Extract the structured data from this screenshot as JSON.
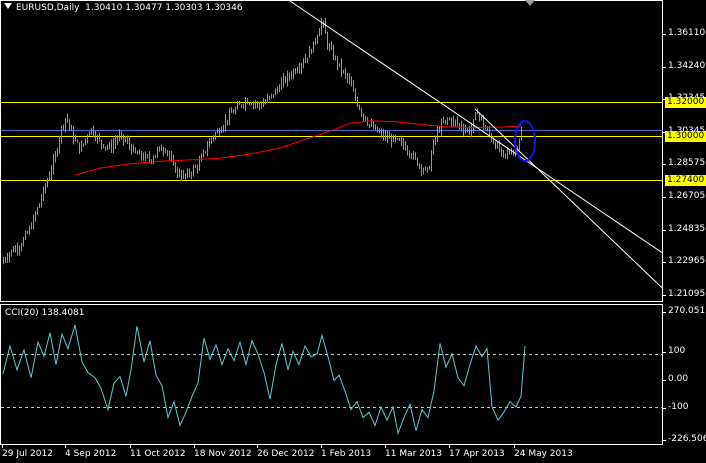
{
  "header": {
    "symbol": "EURUSD,Daily",
    "ohlc": "1.30410 1.30477 1.30303 1.30346"
  },
  "indicator": {
    "label": "CCI(20) 138.4081"
  },
  "colors": {
    "background": "#000000",
    "candles": "#00ff00",
    "moving_average": "#ff0000",
    "horizontal_levels": "#ffff00",
    "channel_lines": "#ffffff",
    "cci_line": "#5fc9d6",
    "highlight_ellipse": "#1010ff",
    "blue_level": "#4f6fd0"
  },
  "chart_data": [
    {
      "type": "candlestick",
      "symbol": "EURUSD",
      "timeframe": "Daily",
      "ylim": [
        1.203,
        1.3795
      ],
      "y_ticks": [
        "1.36110",
        "1.34240",
        "1.32345",
        "1.30345",
        "1.28575",
        "1.26705",
        "1.24835",
        "1.22965",
        "1.21095"
      ],
      "x_labels": [
        "29 Jul 2012",
        "4 Sep 2012",
        "11 Oct 2012",
        "18 Nov 2012",
        "26 Dec 2012",
        "1 Feb 2013",
        "11 Mar 2013",
        "17 Apr 2013",
        "24 May 2013"
      ],
      "close_path": [
        [
          0,
          1.225
        ],
        [
          10,
          1.232
        ],
        [
          20,
          1.236
        ],
        [
          30,
          1.246
        ],
        [
          40,
          1.262
        ],
        [
          48,
          1.276
        ],
        [
          55,
          1.288
        ],
        [
          60,
          1.303
        ],
        [
          66,
          1.312
        ],
        [
          72,
          1.3
        ],
        [
          80,
          1.292
        ],
        [
          90,
          1.305
        ],
        [
          100,
          1.296
        ],
        [
          110,
          1.293
        ],
        [
          118,
          1.3
        ],
        [
          126,
          1.297
        ],
        [
          134,
          1.29
        ],
        [
          142,
          1.288
        ],
        [
          150,
          1.286
        ],
        [
          158,
          1.292
        ],
        [
          166,
          1.293
        ],
        [
          172,
          1.283
        ],
        [
          178,
          1.278
        ],
        [
          185,
          1.276
        ],
        [
          192,
          1.28
        ],
        [
          198,
          1.283
        ],
        [
          205,
          1.292
        ],
        [
          212,
          1.3
        ],
        [
          218,
          1.303
        ],
        [
          225,
          1.309
        ],
        [
          232,
          1.314
        ],
        [
          238,
          1.317
        ],
        [
          245,
          1.321
        ],
        [
          252,
          1.32
        ],
        [
          260,
          1.318
        ],
        [
          268,
          1.322
        ],
        [
          275,
          1.326
        ],
        [
          282,
          1.332
        ],
        [
          288,
          1.335
        ],
        [
          296,
          1.34
        ],
        [
          304,
          1.345
        ],
        [
          312,
          1.352
        ],
        [
          318,
          1.362
        ],
        [
          322,
          1.368
        ],
        [
          327,
          1.354
        ],
        [
          334,
          1.346
        ],
        [
          342,
          1.338
        ],
        [
          349,
          1.332
        ],
        [
          355,
          1.322
        ],
        [
          362,
          1.313
        ],
        [
          370,
          1.306
        ],
        [
          378,
          1.302
        ],
        [
          386,
          1.299
        ],
        [
          393,
          1.298
        ],
        [
          400,
          1.296
        ],
        [
          408,
          1.292
        ],
        [
          415,
          1.286
        ],
        [
          422,
          1.281
        ],
        [
          428,
          1.279
        ],
        [
          433,
          1.296
        ],
        [
          440,
          1.306
        ],
        [
          448,
          1.31
        ],
        [
          455,
          1.308
        ],
        [
          462,
          1.305
        ],
        [
          470,
          1.303
        ],
        [
          477,
          1.315
        ],
        [
          484,
          1.305
        ],
        [
          490,
          1.3
        ],
        [
          496,
          1.294
        ],
        [
          503,
          1.288
        ],
        [
          510,
          1.291
        ],
        [
          516,
          1.293
        ],
        [
          521,
          1.303
        ]
      ],
      "moving_average_path": [
        [
          75,
          1.277
        ],
        [
          100,
          1.2812
        ],
        [
          130,
          1.2838
        ],
        [
          160,
          1.2852
        ],
        [
          190,
          1.286
        ],
        [
          220,
          1.287
        ],
        [
          250,
          1.2895
        ],
        [
          280,
          1.293
        ],
        [
          310,
          1.299
        ],
        [
          330,
          1.303
        ],
        [
          350,
          1.3075
        ],
        [
          370,
          1.309
        ],
        [
          395,
          1.3085
        ],
        [
          420,
          1.307
        ],
        [
          445,
          1.3055
        ],
        [
          470,
          1.305
        ],
        [
          500,
          1.3053
        ],
        [
          521,
          1.3058
        ]
      ],
      "horizontal_levels": [
        {
          "label": "1.32000",
          "value": 1.32
        },
        {
          "label": "1.30000",
          "value": 1.3
        },
        {
          "label": "1.27400",
          "value": 1.274
        }
      ],
      "blue_level": 1.3035,
      "channel_lines": [
        {
          "x1": 290,
          "y1": 1.3795,
          "x2": 662,
          "y2": 1.2315
        },
        {
          "x1": 475,
          "y1": 1.316,
          "x2": 662,
          "y2": 1.2108
        }
      ]
    },
    {
      "type": "line",
      "name": "CCI(20)",
      "ylim": [
        -240,
        285
      ],
      "y_ticks": [
        "270.051",
        "100",
        "0.00",
        "-100",
        "-226.5064"
      ],
      "levels": [
        100,
        -100
      ],
      "values_path": [
        [
          3,
          25
        ],
        [
          10,
          130
        ],
        [
          17,
          40
        ],
        [
          24,
          115
        ],
        [
          31,
          10
        ],
        [
          38,
          145
        ],
        [
          44,
          90
        ],
        [
          50,
          180
        ],
        [
          56,
          60
        ],
        [
          62,
          175
        ],
        [
          68,
          120
        ],
        [
          75,
          210
        ],
        [
          82,
          70
        ],
        [
          88,
          30
        ],
        [
          95,
          10
        ],
        [
          101,
          -30
        ],
        [
          108,
          -110
        ],
        [
          114,
          -10
        ],
        [
          120,
          15
        ],
        [
          126,
          -60
        ],
        [
          131,
          40
        ],
        [
          137,
          205
        ],
        [
          144,
          70
        ],
        [
          150,
          150
        ],
        [
          156,
          20
        ],
        [
          162,
          -20
        ],
        [
          168,
          -140
        ],
        [
          174,
          -80
        ],
        [
          180,
          -170
        ],
        [
          186,
          -120
        ],
        [
          192,
          -60
        ],
        [
          198,
          -10
        ],
        [
          204,
          160
        ],
        [
          210,
          80
        ],
        [
          216,
          135
        ],
        [
          222,
          60
        ],
        [
          228,
          120
        ],
        [
          234,
          75
        ],
        [
          240,
          145
        ],
        [
          246,
          60
        ],
        [
          252,
          150
        ],
        [
          258,
          100
        ],
        [
          264,
          30
        ],
        [
          270,
          -70
        ],
        [
          276,
          60
        ],
        [
          282,
          140
        ],
        [
          288,
          40
        ],
        [
          293,
          110
        ],
        [
          299,
          60
        ],
        [
          305,
          130
        ],
        [
          311,
          90
        ],
        [
          317,
          100
        ],
        [
          322,
          170
        ],
        [
          328,
          90
        ],
        [
          334,
          0
        ],
        [
          339,
          20
        ],
        [
          345,
          -40
        ],
        [
          351,
          -110
        ],
        [
          357,
          -80
        ],
        [
          363,
          -140
        ],
        [
          369,
          -120
        ],
        [
          375,
          -170
        ],
        [
          381,
          -100
        ],
        [
          387,
          -150
        ],
        [
          393,
          -100
        ],
        [
          398,
          -200
        ],
        [
          404,
          -140
        ],
        [
          410,
          -90
        ],
        [
          416,
          -190
        ],
        [
          422,
          -110
        ],
        [
          428,
          -140
        ],
        [
          434,
          -40
        ],
        [
          440,
          140
        ],
        [
          446,
          50
        ],
        [
          452,
          100
        ],
        [
          458,
          10
        ],
        [
          464,
          -20
        ],
        [
          470,
          60
        ],
        [
          476,
          130
        ],
        [
          482,
          90
        ],
        [
          487,
          120
        ],
        [
          492,
          -100
        ],
        [
          498,
          -150
        ],
        [
          504,
          -120
        ],
        [
          510,
          -80
        ],
        [
          516,
          -100
        ],
        [
          521,
          -60
        ],
        [
          525,
          130
        ]
      ]
    }
  ]
}
